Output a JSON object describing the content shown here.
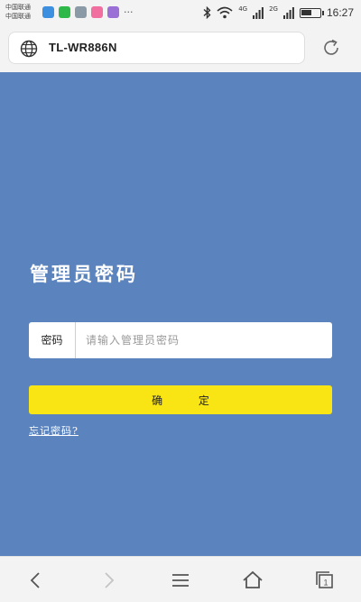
{
  "status_bar": {
    "carrier_line1": "中国联通",
    "carrier_line2": "中国联通",
    "more_indicator": "···",
    "network_4g": "4G",
    "network_2g": "2G",
    "battery_level": 0.6,
    "time": "16:27",
    "icons": [
      "notification-app-icon",
      "wechat-icon",
      "gallery-icon",
      "app-icon",
      "app-icon",
      "bluetooth-icon",
      "wifi-icon",
      "signal-icon",
      "battery-icon"
    ]
  },
  "browser": {
    "address": "TL-WR886N",
    "icons": [
      "globe-icon",
      "refresh-icon"
    ]
  },
  "login": {
    "title": "管理员密码",
    "password_label": "密码",
    "password_value": "",
    "password_placeholder": "请输入管理员密码",
    "confirm_button": "确 定",
    "forgot_link": "忘记密码?"
  },
  "nav": {
    "icons": [
      "back-icon",
      "forward-icon",
      "menu-icon",
      "home-icon",
      "tabs-icon"
    ],
    "tab_count": "1"
  },
  "colors": {
    "page_background": "#5b84bf",
    "confirm_button": "#fae514"
  }
}
